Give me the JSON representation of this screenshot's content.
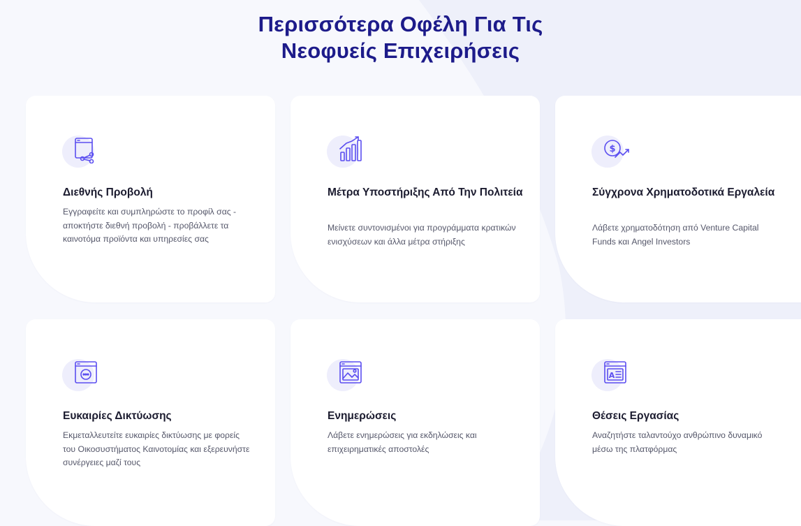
{
  "page": {
    "heading_line1": "Περισσότερα Οφέλη Για Τις",
    "heading_line2": "Νεοφυείς Επιχειρήσεις"
  },
  "colors": {
    "heading": "#1d1b8a",
    "icon_stroke": "#5b4ef0",
    "icon_blob": "#eeeefc",
    "background": "#f7f8fd",
    "background_shape": "#eef0fa",
    "card": "#ffffff"
  },
  "cards": [
    {
      "icon": "browser-share-icon",
      "title": "Διεθνής Προβολή",
      "desc": "Εγγραφείτε και συμπληρώστε το προφίλ σας - αποκτήστε διεθνή προβολή - προβάλλετε τα καινοτόμα προϊόντα και υπηρεσίες σας"
    },
    {
      "icon": "growth-chart-icon",
      "title": "Μέτρα Υποστήριξης Από Την Πολιτεία",
      "desc": "Μείνετε συντονισμένοι για προγράμματα κρατικών ενισχύσεων και άλλα μέτρα στήριξης"
    },
    {
      "icon": "dollar-growth-icon",
      "title": "Σύγχρονα Χρηματοδοτικά Εργαλεία",
      "desc": "Λάβετε χρηματοδότηση από Venture Capital Funds και Angel Investors"
    },
    {
      "icon": "browser-chat-icon",
      "title": "Ευκαιρίες Δικτύωσης",
      "desc": "Εκμεταλλευτείτε ευκαιρίες δικτύωσης με φορείς του Οικοσυστήματος Καινοτομίας και εξερευνήστε συνέργειες μαζί τους"
    },
    {
      "icon": "browser-image-icon",
      "title": "Ενημερώσεις",
      "desc": "Λάβετε ενημερώσεις για εκδηλώσεις και επιχειρηματικές αποστολές"
    },
    {
      "icon": "document-text-icon",
      "title": "Θέσεις Εργασίας",
      "desc": "Αναζητήστε ταλαντούχο ανθρώπινο δυναμικό μέσω της πλατφόρμας"
    }
  ]
}
